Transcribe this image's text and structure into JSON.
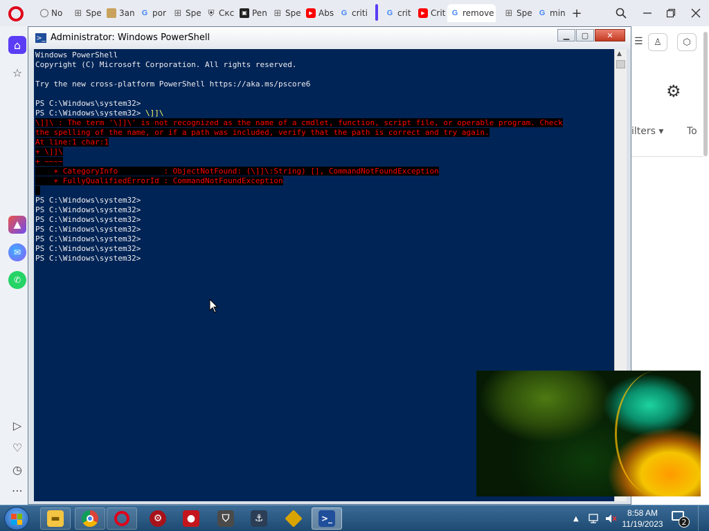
{
  "browser": {
    "tabs": [
      {
        "icon": "circle",
        "label": "No"
      },
      {
        "icon": "grid",
        "label": "Spe"
      },
      {
        "icon": "image",
        "label": "3an"
      },
      {
        "icon": "google",
        "label": "por"
      },
      {
        "icon": "grid",
        "label": "Spe"
      },
      {
        "icon": "shield",
        "label": "Скс"
      },
      {
        "icon": "box",
        "label": "Pen"
      },
      {
        "icon": "grid",
        "label": "Spe"
      },
      {
        "icon": "youtube",
        "label": "Abs"
      },
      {
        "icon": "google",
        "label": "criti"
      },
      {
        "icon": "google",
        "label": "crit"
      },
      {
        "icon": "youtube",
        "label": "Crit"
      },
      {
        "icon": "google",
        "label": "remove"
      },
      {
        "icon": "grid",
        "label": "Spe"
      },
      {
        "icon": "google",
        "label": "min"
      }
    ],
    "new_tab_icon": "+",
    "bg_page": {
      "filters_label": "ilters",
      "to_label": "To"
    }
  },
  "powershell": {
    "title": "Administrator: Windows PowerShell",
    "lines": [
      {
        "text": "Windows PowerShell",
        "type": "normal"
      },
      {
        "text": "Copyright (C) Microsoft Corporation. All rights reserved.",
        "type": "normal"
      },
      {
        "text": "",
        "type": "normal"
      },
      {
        "text": "Try the new cross-platform PowerShell https://aka.ms/pscore6",
        "type": "normal"
      },
      {
        "text": "",
        "type": "normal"
      },
      {
        "text": "PS C:\\Windows\\system32>",
        "type": "normal"
      },
      {
        "text": "PS C:\\Windows\\system32> ",
        "type": "prompt-cmd",
        "cmd": "\\]]\\"
      },
      {
        "text": "\\]]\\ : The term '\\]]\\' is not recognized as the name of a cmdlet, function, script file, or operable program. Check",
        "type": "error"
      },
      {
        "text": "the spelling of the name, or if a path was included, verify that the path is correct and try again.",
        "type": "error"
      },
      {
        "text": "At line:1 char:1",
        "type": "error"
      },
      {
        "text": "+ \\]]\\",
        "type": "error"
      },
      {
        "text": "+ ~~~~",
        "type": "error"
      },
      {
        "text": "    + CategoryInfo          : ObjectNotFound: (\\]]\\:String) [], CommandNotFoundException",
        "type": "error"
      },
      {
        "text": "    + FullyQualifiedErrorId : CommandNotFoundException",
        "type": "error"
      },
      {
        "text": " ",
        "type": "error"
      },
      {
        "text": "PS C:\\Windows\\system32>",
        "type": "normal"
      },
      {
        "text": "PS C:\\Windows\\system32>",
        "type": "normal"
      },
      {
        "text": "PS C:\\Windows\\system32>",
        "type": "normal"
      },
      {
        "text": "PS C:\\Windows\\system32>",
        "type": "normal"
      },
      {
        "text": "PS C:\\Windows\\system32>",
        "type": "normal"
      },
      {
        "text": "PS C:\\Windows\\system32>",
        "type": "normal"
      },
      {
        "text": "PS C:\\Windows\\system32>",
        "type": "normal"
      }
    ],
    "colors": {
      "background": "#012456",
      "text": "#eeedf0",
      "error": "#ff0000",
      "command": "#ffff60"
    }
  },
  "taskbar": {
    "items": [
      {
        "name": "file-explorer",
        "icon": "folder-icon"
      },
      {
        "name": "chrome",
        "icon": "chrome-icon"
      },
      {
        "name": "opera",
        "icon": "opera-icon"
      },
      {
        "name": "app-red-gear",
        "icon": "gear-badge-icon"
      },
      {
        "name": "screen-recorder",
        "icon": "record-icon"
      },
      {
        "name": "world-of-tanks",
        "icon": "tank-icon"
      },
      {
        "name": "world-of-warships",
        "icon": "ship-icon"
      },
      {
        "name": "app-diamond",
        "icon": "diamond-icon"
      },
      {
        "name": "powershell",
        "icon": "powershell-icon"
      }
    ],
    "clock_time": "8:58 AM",
    "clock_date": "11/19/2023",
    "notification_count": "2"
  }
}
